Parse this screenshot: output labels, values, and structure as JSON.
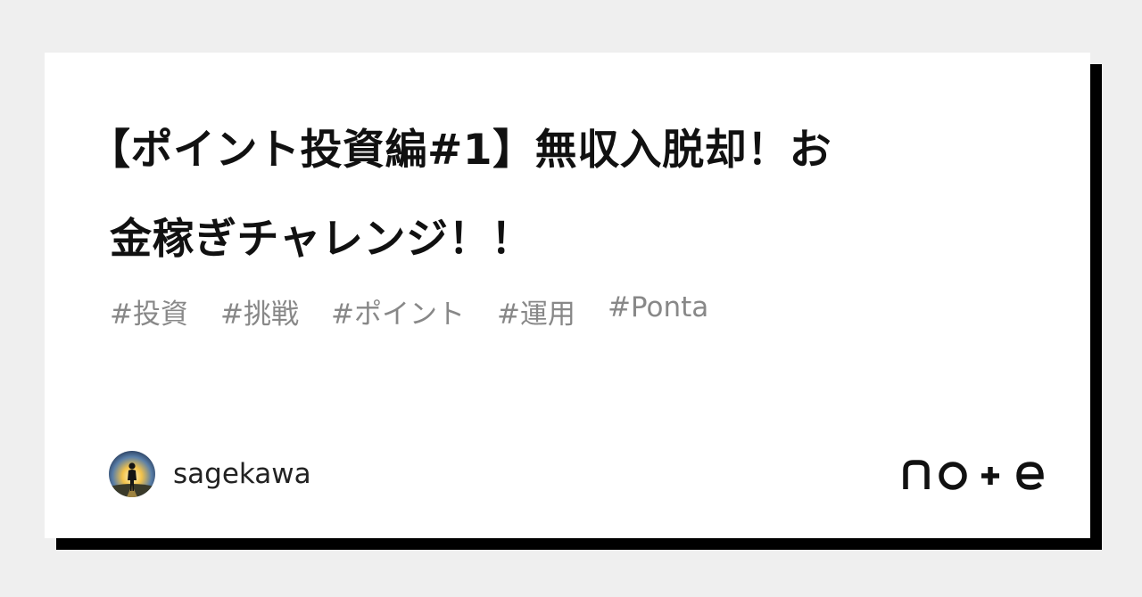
{
  "article": {
    "title_line1": "【ポイント投資編#1】無収入脱却！お",
    "title_line2": "金稼ぎチャレンジ！！",
    "tags": [
      "#投資",
      "#挑戦",
      "#ポイント",
      "#運用",
      "#Ponta"
    ]
  },
  "author": {
    "name": "sagekawa"
  },
  "brand": {
    "logo_text": "note"
  },
  "colors": {
    "background": "#efefef",
    "card": "#ffffff",
    "shadow": "#000000",
    "title": "#111111",
    "tags": "#888888"
  }
}
